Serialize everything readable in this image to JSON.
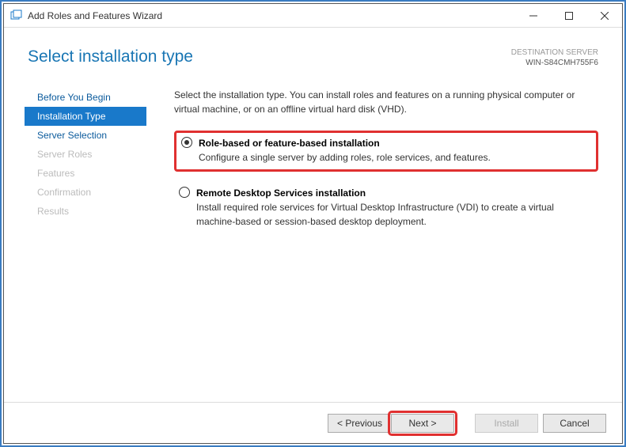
{
  "titlebar": {
    "text": "Add Roles and Features Wizard"
  },
  "header": {
    "title": "Select installation type",
    "dest_label": "DESTINATION SERVER",
    "dest_name": "WIN-S84CMH755F6"
  },
  "sidebar": {
    "items": [
      {
        "label": "Before You Begin",
        "state": "enabled"
      },
      {
        "label": "Installation Type",
        "state": "active"
      },
      {
        "label": "Server Selection",
        "state": "enabled"
      },
      {
        "label": "Server Roles",
        "state": "disabled"
      },
      {
        "label": "Features",
        "state": "disabled"
      },
      {
        "label": "Confirmation",
        "state": "disabled"
      },
      {
        "label": "Results",
        "state": "disabled"
      }
    ]
  },
  "content": {
    "intro": "Select the installation type. You can install roles and features on a running physical computer or virtual machine, or on an offline virtual hard disk (VHD).",
    "options": [
      {
        "title": "Role-based or feature-based installation",
        "desc": "Configure a single server by adding roles, role services, and features.",
        "selected": true,
        "highlighted": true
      },
      {
        "title": "Remote Desktop Services installation",
        "desc": "Install required role services for Virtual Desktop Infrastructure (VDI) to create a virtual machine-based or session-based desktop deployment.",
        "selected": false,
        "highlighted": false
      }
    ]
  },
  "footer": {
    "previous": "< Previous",
    "next": "Next >",
    "install": "Install",
    "cancel": "Cancel"
  }
}
